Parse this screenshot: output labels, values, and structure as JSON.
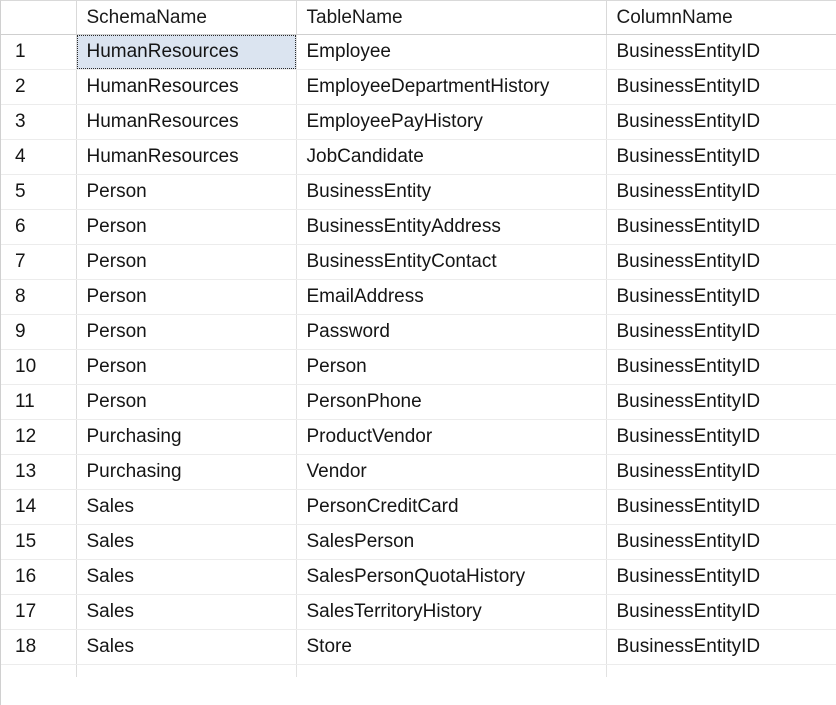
{
  "grid": {
    "row_number_header": "",
    "columns": [
      "SchemaName",
      "TableName",
      "ColumnName"
    ],
    "selected_cell": {
      "row": 1,
      "column": "SchemaName",
      "value": "HumanResources"
    },
    "row_count": 18,
    "rows": [
      {
        "num": "1",
        "SchemaName": "HumanResources",
        "TableName": "Employee",
        "ColumnName": "BusinessEntityID"
      },
      {
        "num": "2",
        "SchemaName": "HumanResources",
        "TableName": "EmployeeDepartmentHistory",
        "ColumnName": "BusinessEntityID"
      },
      {
        "num": "3",
        "SchemaName": "HumanResources",
        "TableName": "EmployeePayHistory",
        "ColumnName": "BusinessEntityID"
      },
      {
        "num": "4",
        "SchemaName": "HumanResources",
        "TableName": "JobCandidate",
        "ColumnName": "BusinessEntityID"
      },
      {
        "num": "5",
        "SchemaName": "Person",
        "TableName": "BusinessEntity",
        "ColumnName": "BusinessEntityID"
      },
      {
        "num": "6",
        "SchemaName": "Person",
        "TableName": "BusinessEntityAddress",
        "ColumnName": "BusinessEntityID"
      },
      {
        "num": "7",
        "SchemaName": "Person",
        "TableName": "BusinessEntityContact",
        "ColumnName": "BusinessEntityID"
      },
      {
        "num": "8",
        "SchemaName": "Person",
        "TableName": "EmailAddress",
        "ColumnName": "BusinessEntityID"
      },
      {
        "num": "9",
        "SchemaName": "Person",
        "TableName": "Password",
        "ColumnName": "BusinessEntityID"
      },
      {
        "num": "10",
        "SchemaName": "Person",
        "TableName": "Person",
        "ColumnName": "BusinessEntityID"
      },
      {
        "num": "11",
        "SchemaName": "Person",
        "TableName": "PersonPhone",
        "ColumnName": "BusinessEntityID"
      },
      {
        "num": "12",
        "SchemaName": "Purchasing",
        "TableName": "ProductVendor",
        "ColumnName": "BusinessEntityID"
      },
      {
        "num": "13",
        "SchemaName": "Purchasing",
        "TableName": "Vendor",
        "ColumnName": "BusinessEntityID"
      },
      {
        "num": "14",
        "SchemaName": "Sales",
        "TableName": "PersonCreditCard",
        "ColumnName": "BusinessEntityID"
      },
      {
        "num": "15",
        "SchemaName": "Sales",
        "TableName": "SalesPerson",
        "ColumnName": "BusinessEntityID"
      },
      {
        "num": "16",
        "SchemaName": "Sales",
        "TableName": "SalesPersonQuotaHistory",
        "ColumnName": "BusinessEntityID"
      },
      {
        "num": "17",
        "SchemaName": "Sales",
        "TableName": "SalesTerritoryHistory",
        "ColumnName": "BusinessEntityID"
      },
      {
        "num": "18",
        "SchemaName": "Sales",
        "TableName": "Store",
        "ColumnName": "BusinessEntityID"
      }
    ]
  },
  "colors": {
    "selection_fill": "#dbe4f0",
    "focus_border": "#2b2b2b",
    "grid_line": "#e2e2e2",
    "header_line": "#cfcfcf",
    "text": "#151515",
    "background": "#ffffff"
  }
}
